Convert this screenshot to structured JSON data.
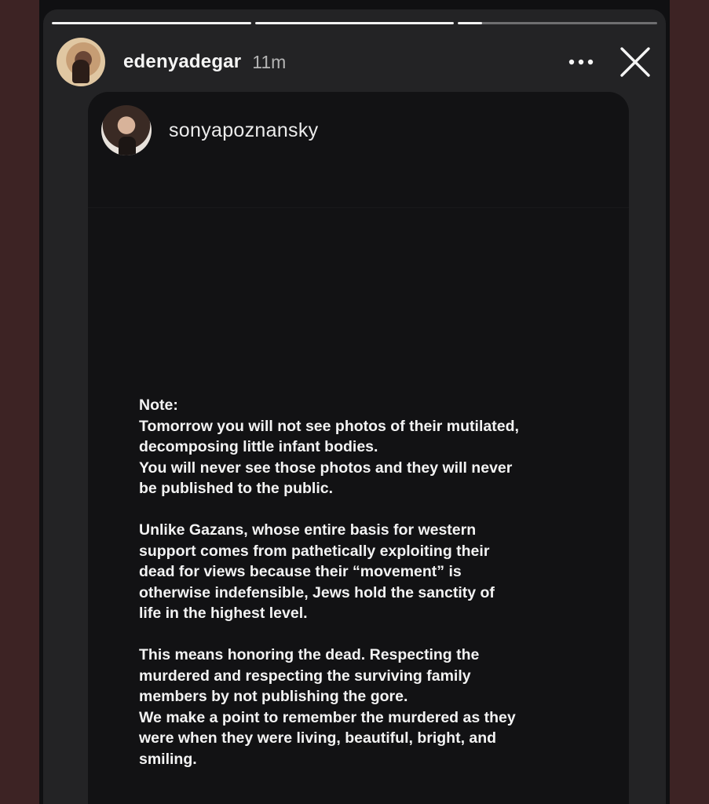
{
  "story": {
    "progress": [
      1.0,
      1.0,
      0.12
    ],
    "username": "edenyadegar",
    "time": "11m",
    "more_icon": "more-horizontal-icon",
    "close_icon": "close-icon"
  },
  "shared_post": {
    "username": "sonyapoznansky",
    "paragraphs": [
      [
        "Note:",
        "Tomorrow you will not see photos of their mutilated,",
        "decomposing little infant bodies.",
        "You will never see those photos and they will never",
        "be published to the public."
      ],
      [
        "Unlike Gazans, whose entire basis for western",
        "support comes from pathetically exploiting their",
        "dead for views because their “movement” is",
        "otherwise indefensible, Jews hold the sanctity of",
        "life in the highest level."
      ],
      [
        "This means honoring the dead. Respecting the",
        "murdered and respecting the surviving family",
        "members by not publishing the gore.",
        "We make a point to remember the murdered as they",
        "were when they were living, beautiful, bright, and",
        "smiling."
      ]
    ]
  },
  "colors": {
    "background": "#3d2324",
    "story_frame": "#232325",
    "card": "#121214",
    "text": "#f3f3f3"
  }
}
